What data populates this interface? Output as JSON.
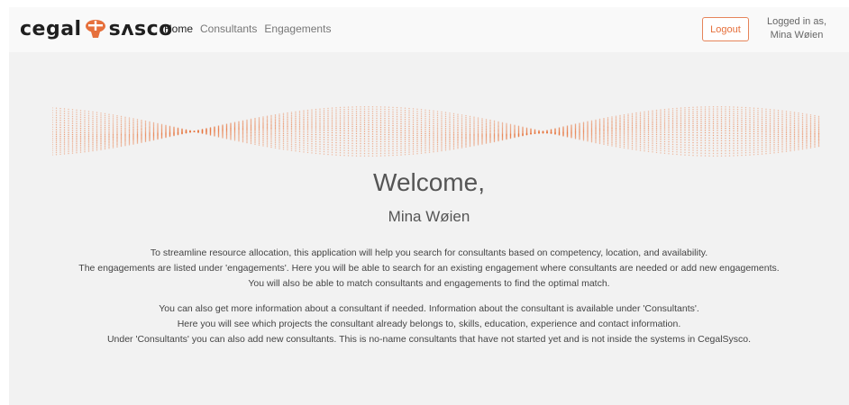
{
  "navbar": {
    "logo_left": "cegal",
    "logo_right": "sʌsco",
    "links": [
      {
        "label": "Home",
        "active": true
      },
      {
        "label": "Consultants",
        "active": false
      },
      {
        "label": "Engagements",
        "active": false
      }
    ],
    "logout_label": "Logout",
    "logged_in_label": "Logged in as,",
    "user_name": "Mina Wøien"
  },
  "main": {
    "welcome_title": "Welcome,",
    "welcome_name": "Mina Wøien",
    "paragraph1": [
      "To streamline resource allocation, this application will help you search for consultants based on competency, location, and availability.",
      "The engagements are listed under 'engagements'. Here you will be able to search for an existing engagement where consultants are needed or add new engagements.",
      "You will also be able to match consultants and engagements to find the optimal match."
    ],
    "paragraph2": [
      "You can also get more information about a consultant if needed. Information about the consultant is available under 'Consultants'.",
      "Here you will see which projects the consultant already belongs to, skills, education, experience and contact information.",
      "Under 'Consultants' you can also add new consultants. This is no-name consultants that have not started yet and is not inside the systems in CegalSysco."
    ]
  },
  "colors": {
    "accent": "#e6703c",
    "wave": "#e8763f",
    "background": "#f2f2f2",
    "navbar": "#f9f9f9"
  }
}
